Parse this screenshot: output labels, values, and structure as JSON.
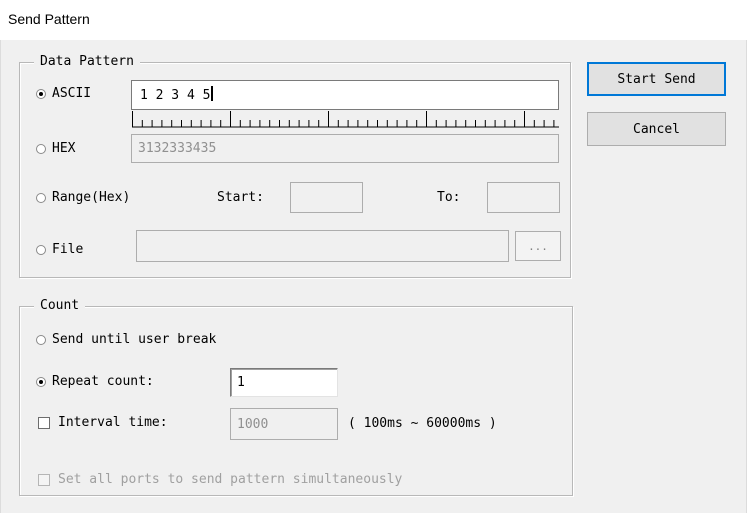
{
  "window": {
    "title": "Send Pattern"
  },
  "data_pattern": {
    "group_title": "Data Pattern",
    "ascii": {
      "label": "ASCII",
      "value": "1 2 3 4 5",
      "selected": true
    },
    "hex": {
      "label": "HEX",
      "value": "3132333435",
      "selected": false
    },
    "range": {
      "label": "Range(Hex)",
      "start_label": "Start:",
      "to_label": "To:",
      "start_value": "",
      "to_value": "",
      "selected": false
    },
    "file": {
      "label": "File",
      "value": "",
      "browse_label": "...",
      "selected": false
    }
  },
  "count": {
    "group_title": "Count",
    "until_break": {
      "label": "Send until user break",
      "selected": false
    },
    "repeat": {
      "label": "Repeat count:",
      "value": "1",
      "selected": true
    },
    "interval": {
      "label": "Interval time:",
      "value": "1000",
      "range_hint": "( 100ms ~ 60000ms )",
      "checked": false
    }
  },
  "all_ports": {
    "label": "Set all ports to send pattern simultaneously",
    "checked": false,
    "enabled": false
  },
  "buttons": {
    "start_send": "Start Send",
    "cancel": "Cancel"
  },
  "colors": {
    "dialog_bg": "#f0f0f0",
    "focus_border": "#0078d7"
  }
}
